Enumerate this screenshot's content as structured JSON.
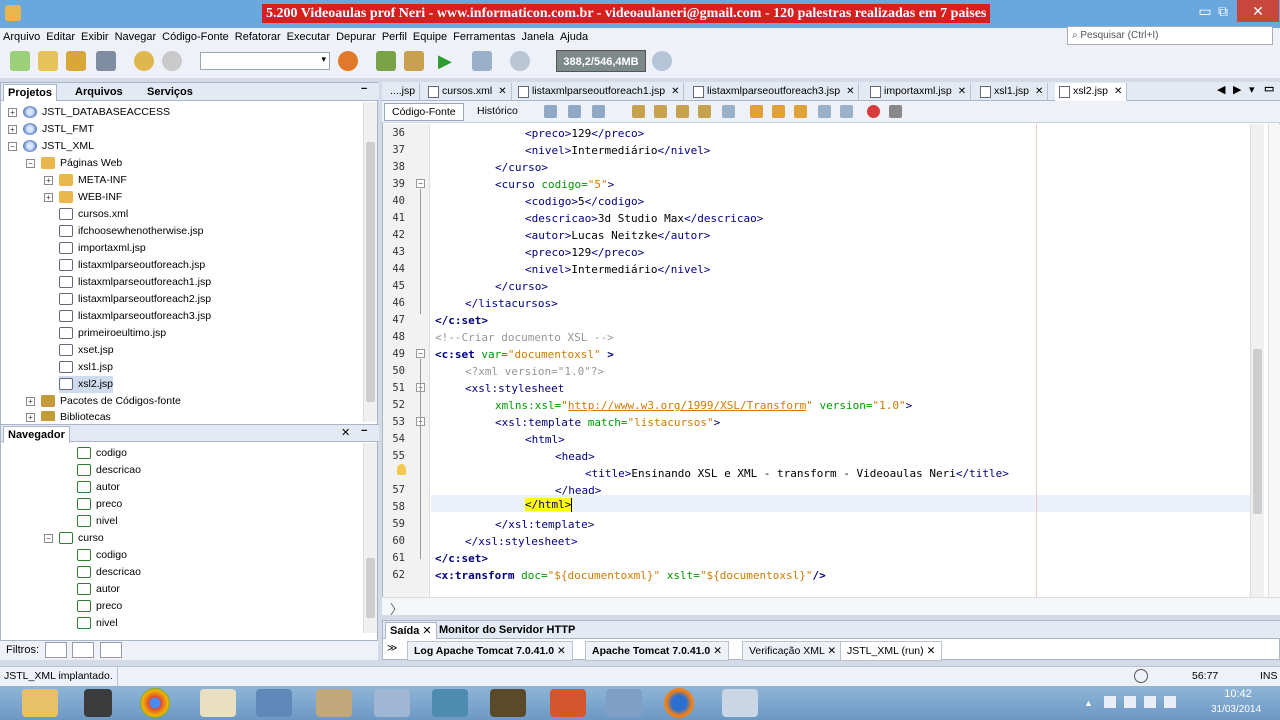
{
  "banner": "5.200 Videoaulas prof Neri - www.informaticon.com.br - videoaulaneri@gmail.com - 120 palestras realizadas em 7 paises",
  "window_controls": {
    "minimize": "▭",
    "maximize": "⧉",
    "close": "✕"
  },
  "menu": [
    "Arquivo",
    "Editar",
    "Exibir",
    "Navegar",
    "Código-Fonte",
    "Refatorar",
    "Executar",
    "Depurar",
    "Perfil",
    "Equipe",
    "Ferramentas",
    "Janela",
    "Ajuda"
  ],
  "search_placeholder": "Pesquisar (Ctrl+I)",
  "memory": "388,2/546,4MB",
  "projects_tabs": [
    "Projetos",
    "Arquivos",
    "Serviços"
  ],
  "tree": [
    "JSTL_DATABASEACCESS",
    "JSTL_FMT",
    "JSTL_XML",
    "Páginas Web",
    "META-INF",
    "WEB-INF",
    "cursos.xml",
    "ifchoosewhenotherwise.jsp",
    "importaxml.jsp",
    "listaxmlparseoutforeach.jsp",
    "listaxmlparseoutforeach1.jsp",
    "listaxmlparseoutforeach2.jsp",
    "listaxmlparseoutforeach3.jsp",
    "primeiroeultimo.jsp",
    "xset.jsp",
    "xsl1.jsp",
    "xsl2.jsp",
    "Pacotes de Códigos-fonte",
    "Bibliotecas"
  ],
  "navigator_title": "Navegador",
  "navigator": [
    "codigo",
    "descricao",
    "autor",
    "preco",
    "nivel",
    "curso",
    "codigo",
    "descricao",
    "autor",
    "preco",
    "nivel"
  ],
  "filters_label": "Filtros:",
  "editor_tabs": [
    "....jsp",
    "cursos.xml",
    "listaxmlparseoutforeach1.jsp",
    "listaxmlparseoutforeach3.jsp",
    "importaxml.jsp",
    "xsl1.jsp",
    "xsl2.jsp"
  ],
  "source_tabs": [
    "Código-Fonte",
    "Histórico"
  ],
  "line_numbers": [
    "36",
    "37",
    "38",
    "39",
    "40",
    "41",
    "42",
    "43",
    "44",
    "45",
    "46",
    "47",
    "48",
    "49",
    "50",
    "51",
    "52",
    "53",
    "54",
    "55",
    "56",
    "57",
    "58",
    "59",
    "60",
    "61",
    "62"
  ],
  "code": {
    "l36": [
      "<preco>",
      "129",
      "</preco>"
    ],
    "l37": [
      "<nivel>",
      "Intermediário",
      "</nivel>"
    ],
    "l38": "</curso>",
    "l39": [
      "<curso ",
      "codigo=",
      "\"5\"",
      ">"
    ],
    "l40": [
      "<codigo>",
      "5",
      "</codigo>"
    ],
    "l41": [
      "<descricao>",
      "3d Studio Max",
      "</descricao>"
    ],
    "l42": [
      "<autor>",
      "Lucas Neitzke",
      "</autor>"
    ],
    "l43": [
      "<preco>",
      "129",
      "</preco>"
    ],
    "l44": [
      "<nivel>",
      "Intermediário",
      "</nivel>"
    ],
    "l45": "</curso>",
    "l46": "</listacursos>",
    "l47": "</c:set>",
    "l48": "<!--Criar documento XSL -->",
    "l49": [
      "<c:set ",
      "var=",
      "\"documentoxsl\"",
      " >"
    ],
    "l50": "<?xml version=\"1.0\"?>",
    "l51": "<xsl:stylesheet",
    "l52": [
      "xmlns:xsl=",
      "\"",
      "http://www.w3.org/1999/XSL/Transform",
      "\"",
      "version=",
      "\"1.0\"",
      ">"
    ],
    "l53": [
      "<xsl:template ",
      "match=",
      "\"listacursos\"",
      ">"
    ],
    "l54": "<html>",
    "l55": "<head>",
    "l56": [
      "<title>",
      "Ensinando XSL e XML - transform - Videoaulas Neri",
      "</title>"
    ],
    "l57": "</head>",
    "l58": "</html>",
    "l59": "</xsl:template>",
    "l60": "</xsl:stylesheet>",
    "l61": "</c:set>",
    "l62": [
      "<x:transform ",
      "doc=",
      "\"${documentoxml}\"",
      " xslt=",
      "\"${documentoxsl}\"",
      "/>"
    ]
  },
  "output_tabs": [
    "Saída",
    "Monitor do Servidor HTTP"
  ],
  "output_subtabs": [
    "Log Apache Tomcat 7.0.41.0",
    "Apache Tomcat 7.0.41.0",
    "Verificação XML",
    "JSTL_XML (run)"
  ],
  "status": {
    "message": "JSTL_XML implantado.",
    "position": "56:77",
    "mode": "INS"
  },
  "clock": {
    "time": "10:42",
    "date": "31/03/2014"
  }
}
